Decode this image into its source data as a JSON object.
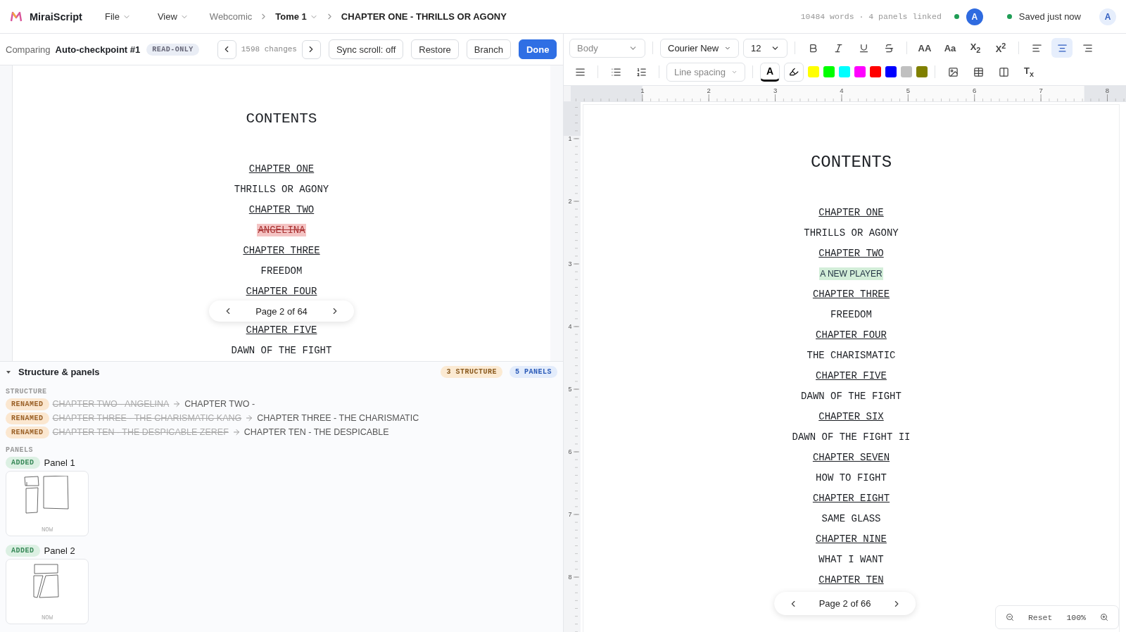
{
  "app": {
    "name": "MiraiScript"
  },
  "menus": [
    {
      "label": "File"
    },
    {
      "label": "View"
    }
  ],
  "breadcrumb": [
    {
      "label": "Webcomic",
      "kind": "link"
    },
    {
      "label": "Tome 1",
      "kind": "dropdown"
    },
    {
      "label": "CHAPTER ONE - THRILLS OR AGONY",
      "kind": "current"
    }
  ],
  "stats": "10484 words · 4 panels linked",
  "collaborator": {
    "initial": "A",
    "online": true
  },
  "save_status": {
    "label": "Saved just now",
    "saved": true
  },
  "user": {
    "initial": "A"
  },
  "compare_bar": {
    "label": "Comparing",
    "checkpoint": "Auto-checkpoint #1",
    "badge": "READ-ONLY",
    "changes": "1598 changes",
    "buttons": [
      {
        "label": "Sync scroll: off",
        "kind": "secondary"
      },
      {
        "label": "Restore",
        "kind": "secondary"
      },
      {
        "label": "Branch",
        "kind": "secondary"
      },
      {
        "label": "Done",
        "kind": "primary"
      }
    ]
  },
  "checkpoint_doc": {
    "title": "CONTENTS",
    "lines_above": [
      {
        "text": "CHAPTER ONE",
        "kind": "chapter"
      },
      {
        "text": "THRILLS OR AGONY",
        "kind": "title"
      },
      {
        "text": "CHAPTER TWO",
        "kind": "chapter"
      },
      {
        "text": "ANGELINA",
        "kind": "deleted"
      },
      {
        "text": "CHAPTER THREE",
        "kind": "chapter"
      },
      {
        "text": "FREEDOM",
        "kind": "title"
      },
      {
        "text": "CHAPTER FOUR",
        "kind": "chapter"
      }
    ],
    "pager": "Page 2 of 64",
    "lines_below": [
      {
        "text": "CHAPTER FIVE",
        "kind": "chapter"
      },
      {
        "text": "DAWN OF THE FIGHT",
        "kind": "title"
      }
    ]
  },
  "structure_panel": {
    "title": "Structure & panels",
    "expanded": true,
    "counts": [
      {
        "label": "3 STRUCTURE",
        "kind": "structure"
      },
      {
        "label": "5 PANELS",
        "kind": "panels"
      }
    ],
    "structure_label": "STRUCTURE",
    "structure_changes": [
      {
        "badge": "RENAMED",
        "old": "CHAPTER TWO - ANGELINA",
        "new": "CHAPTER TWO -"
      },
      {
        "badge": "RENAMED",
        "old": "CHAPTER THREE - THE CHARISMATIC KANG",
        "new": "CHAPTER THREE - THE CHARISMATIC"
      },
      {
        "badge": "RENAMED",
        "old": "CHAPTER TEN - THE DESPICABLE ZEREF",
        "new": "CHAPTER TEN - THE DESPICABLE"
      }
    ],
    "panels_label": "PANELS",
    "panels": [
      {
        "badge": "ADDED",
        "name": "Panel 1",
        "time": "NOW",
        "kind": "split"
      },
      {
        "badge": "ADDED",
        "name": "Panel 2",
        "time": "NOW",
        "kind": "stacked"
      }
    ]
  },
  "toolbar": {
    "style_select": "Body",
    "font_select": "Courier New",
    "size_select": "12",
    "format_buttons": [
      {
        "kind": "bold"
      },
      {
        "kind": "italic"
      },
      {
        "kind": "underline"
      },
      {
        "kind": "strike"
      }
    ],
    "text_buttons": [
      {
        "label": "AA"
      },
      {
        "label": "Aa"
      },
      {
        "label": "X$_{2}$"
      },
      {
        "label": "X$^{2}$"
      }
    ],
    "align_buttons": [
      {
        "kind": "left",
        "selected": false
      },
      {
        "kind": "center",
        "selected": true
      },
      {
        "kind": "right",
        "selected": false
      }
    ],
    "list_buttons": [
      {
        "kind": "justify"
      },
      {
        "kind": "bullets"
      },
      {
        "kind": "numbered"
      }
    ],
    "line_spacing": {
      "placeholder": "Line spacing"
    },
    "text_color": {
      "label": "A",
      "selected": true
    },
    "highlight": {
      "selected": false
    },
    "swatches": [
      {
        "color": "#ffff00"
      },
      {
        "color": "#00ff00"
      },
      {
        "color": "#00ffff"
      },
      {
        "color": "#ff00ff"
      },
      {
        "color": "#ff0000"
      },
      {
        "color": "#0000ff"
      },
      {
        "color": "#c0c0c0"
      },
      {
        "color": "#808000"
      }
    ],
    "insert_buttons": [
      {
        "kind": "image"
      },
      {
        "kind": "table"
      },
      {
        "kind": "page"
      }
    ],
    "clear_format": "T$_{x}$"
  },
  "ruler": {
    "horizontal": [
      "1",
      "2",
      "3",
      "4",
      "5",
      "6",
      "7",
      "8"
    ],
    "vertical": [
      "1",
      "2",
      "3",
      "4",
      "5",
      "6",
      "7",
      "8"
    ]
  },
  "editor_doc": {
    "title": "CONTENTS",
    "lines": [
      {
        "text": "CHAPTER ONE",
        "kind": "chapter"
      },
      {
        "text": "THRILLS OR AGONY",
        "kind": "title"
      },
      {
        "text": "CHAPTER TWO",
        "kind": "chapter"
      },
      {
        "text": "A NEW PLAYER",
        "kind": "added"
      },
      {
        "text": "CHAPTER THREE",
        "kind": "chapter"
      },
      {
        "text": "FREEDOM",
        "kind": "title"
      },
      {
        "text": "CHAPTER FOUR",
        "kind": "chapter"
      },
      {
        "text": "THE CHARISMATIC",
        "kind": "title"
      },
      {
        "text": "CHAPTER FIVE",
        "kind": "chapter"
      },
      {
        "text": "DAWN OF THE FIGHT",
        "kind": "title"
      },
      {
        "text": "CHAPTER SIX",
        "kind": "chapter"
      },
      {
        "text": "DAWN OF THE FIGHT II",
        "kind": "title"
      },
      {
        "text": "CHAPTER SEVEN",
        "kind": "chapter"
      },
      {
        "text": "HOW TO FIGHT",
        "kind": "title"
      },
      {
        "text": "CHAPTER EIGHT",
        "kind": "chapter"
      },
      {
        "text": "SAME GLASS",
        "kind": "title"
      },
      {
        "text": "CHAPTER NINE",
        "kind": "chapter"
      },
      {
        "text": "WHAT I WANT",
        "kind": "title"
      },
      {
        "text": "CHAPTER TEN",
        "kind": "chapter"
      }
    ],
    "pager": "Page 2 of 66"
  },
  "zoom": {
    "reset": "Reset",
    "level": "100%"
  }
}
